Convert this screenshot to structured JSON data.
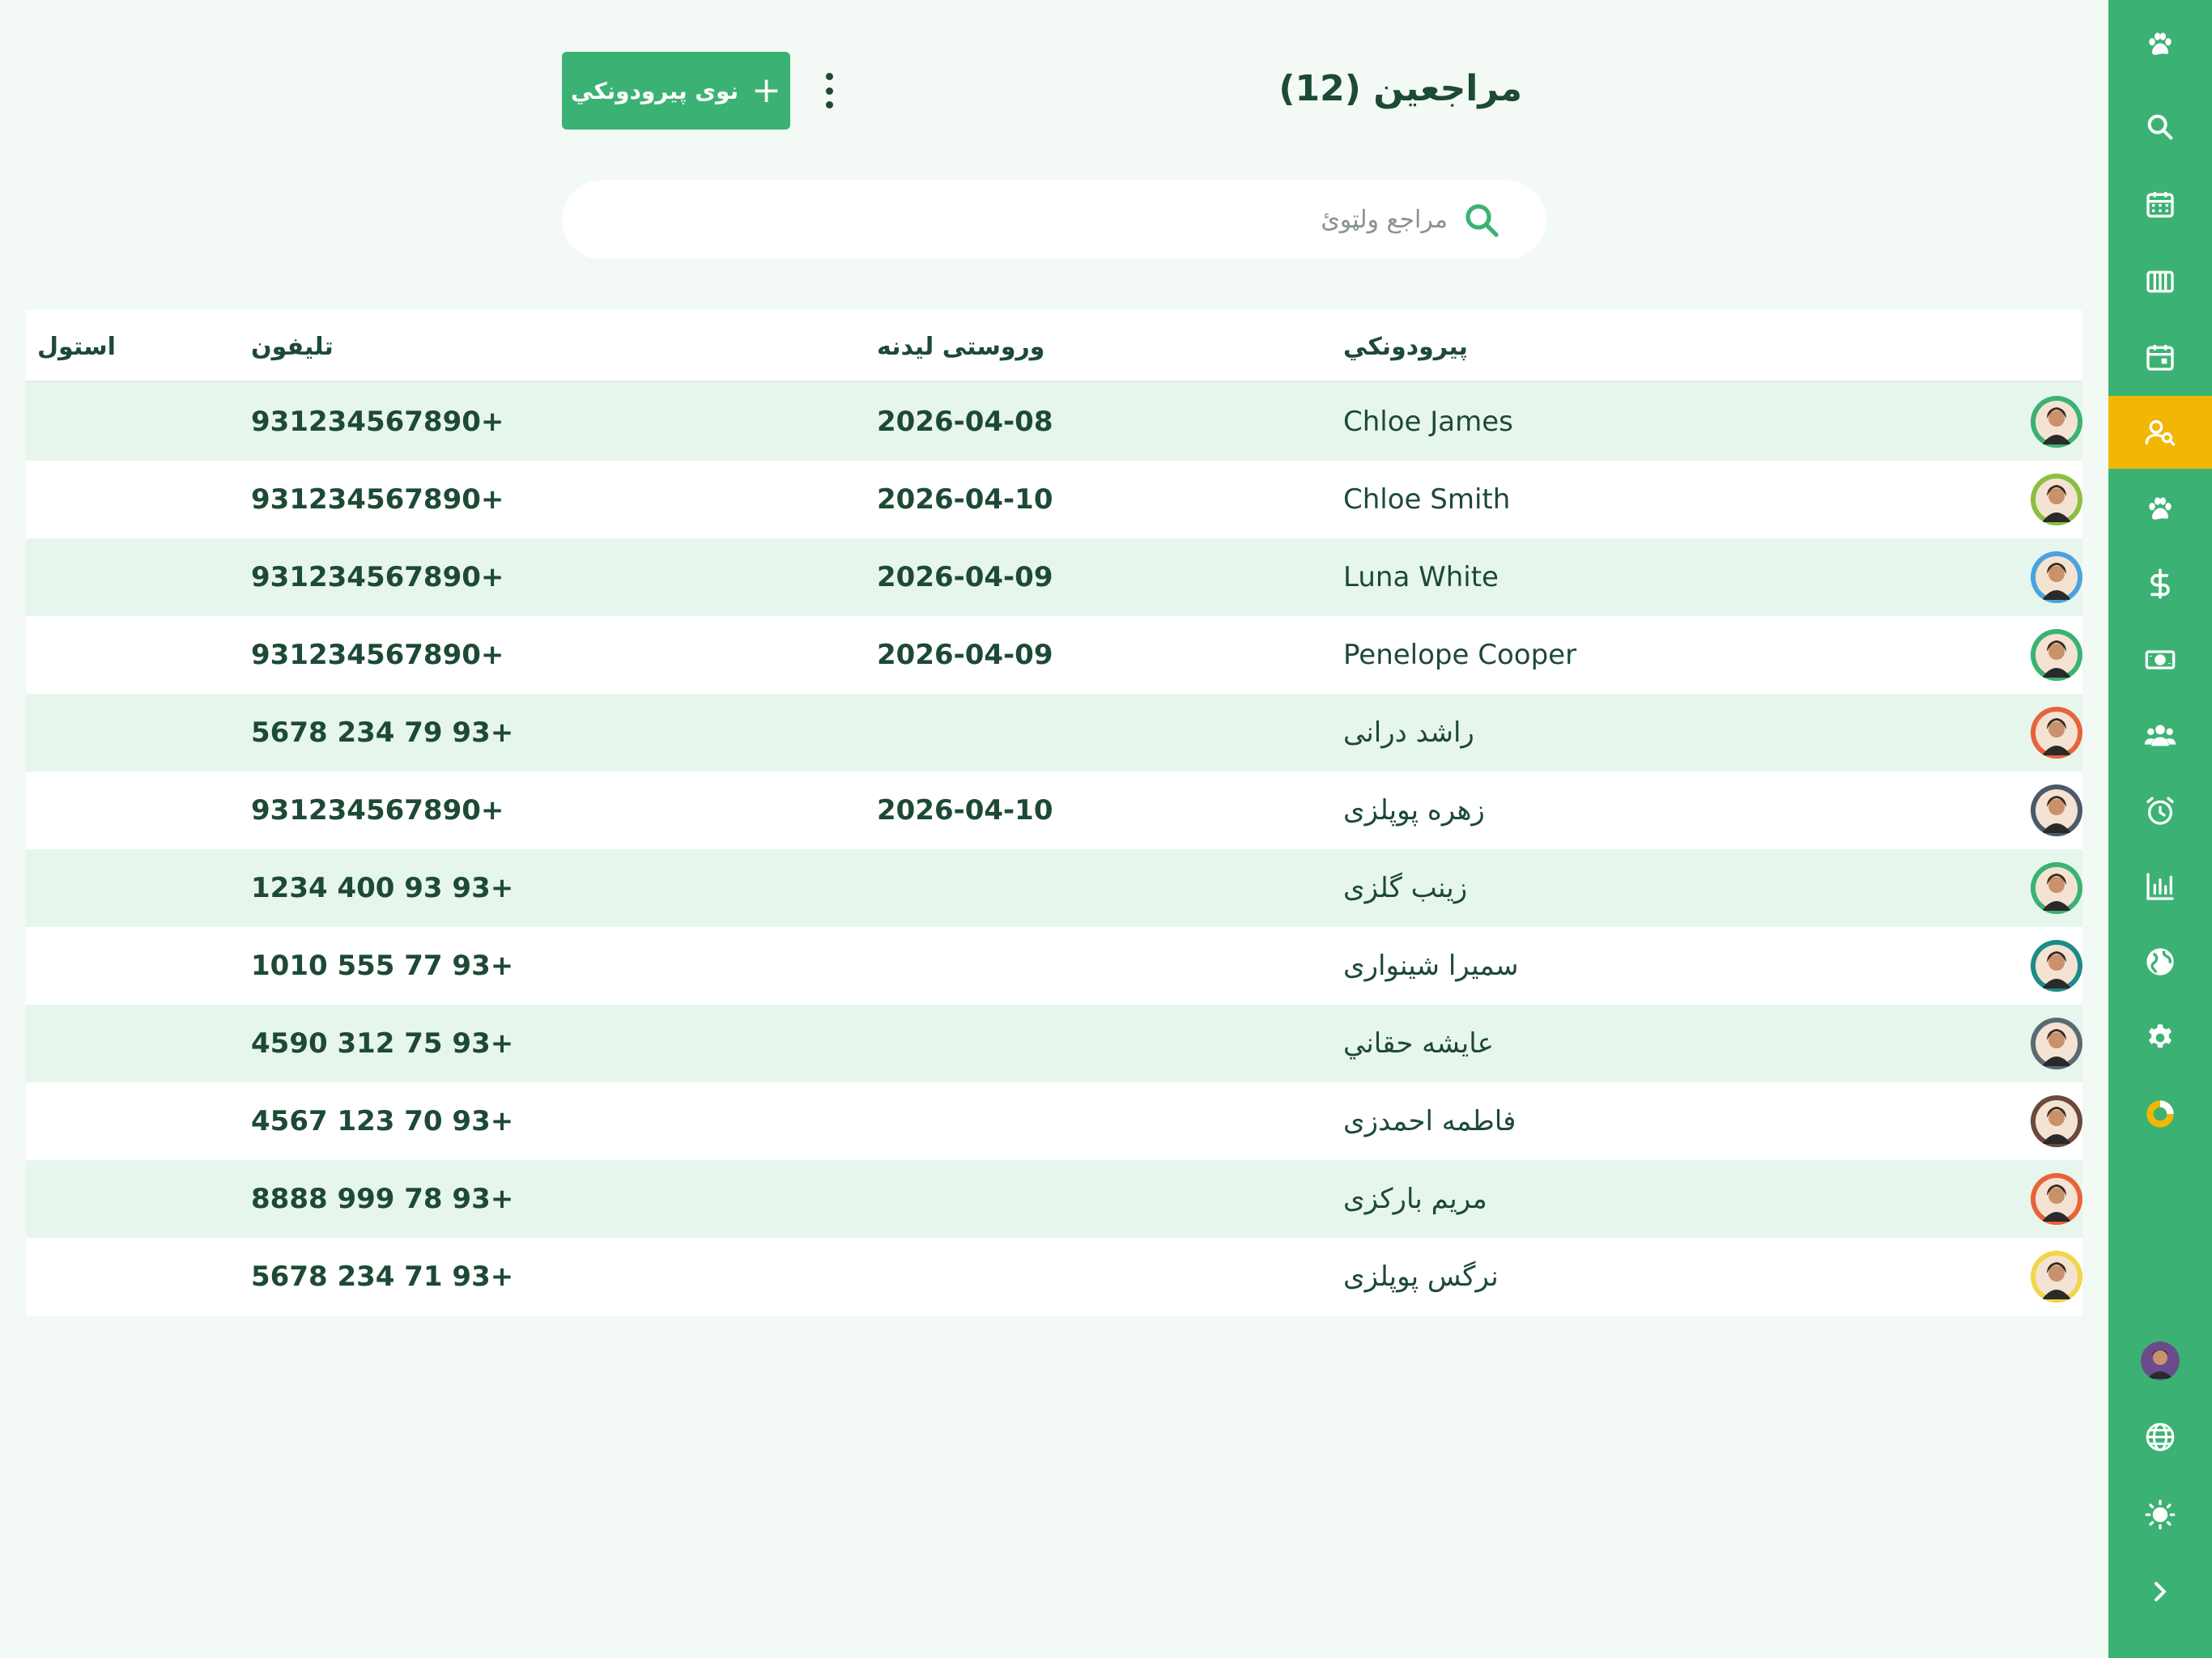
{
  "header": {
    "title": "مراجعين (12)",
    "new_button_label": "نوی پیرودونکي",
    "new_button_icon": "plus-icon",
    "more_icon": "kebab-menu-icon"
  },
  "search": {
    "placeholder": "مراجع ولټوئ",
    "value": "",
    "icon": "search-icon"
  },
  "table": {
    "columns": {
      "customer": "پیرودونکي",
      "last_visit": "وروستی لیدنه",
      "phone": "تلیفون",
      "column": "استول"
    },
    "rows": [
      {
        "name": "Chloe James",
        "date": "2026-04-08",
        "phone": "931234567890+",
        "avatar_color": "#3bb273"
      },
      {
        "name": "Chloe Smith",
        "date": "2026-04-10",
        "phone": "931234567890+",
        "avatar_color": "#8bbf3f"
      },
      {
        "name": "Luna White",
        "date": "2026-04-09",
        "phone": "931234567890+",
        "avatar_color": "#4aa3df"
      },
      {
        "name": "Penelope Cooper",
        "date": "2026-04-09",
        "phone": "931234567890+",
        "avatar_color": "#3bb273"
      },
      {
        "name": "راشد درانی",
        "date": "",
        "phone": "5678 234 79 93+",
        "avatar_color": "#e8633a"
      },
      {
        "name": "زهره پوپلزی",
        "date": "2026-04-10",
        "phone": "931234567890+",
        "avatar_color": "#4a5a6a"
      },
      {
        "name": "زینب گلزی",
        "date": "",
        "phone": "1234 400 93 93+",
        "avatar_color": "#3bb273"
      },
      {
        "name": "سمیرا شینواری",
        "date": "",
        "phone": "1010 555 77 93+",
        "avatar_color": "#1e8a8a"
      },
      {
        "name": "عایشه حقاني",
        "date": "",
        "phone": "4590 312 75 93+",
        "avatar_color": "#5a6a72"
      },
      {
        "name": "فاطمه احمدزی",
        "date": "",
        "phone": "4567 123 70 93+",
        "avatar_color": "#6b4a3a"
      },
      {
        "name": "مریم بارکزی",
        "date": "",
        "phone": "8888 999 78 93+",
        "avatar_color": "#e8633a"
      },
      {
        "name": "نرگس پوپلزی",
        "date": "",
        "phone": "5678 234 71 93+",
        "avatar_color": "#f2d54a"
      }
    ]
  },
  "sidebar": {
    "items": [
      {
        "icon": "paw-logo-icon",
        "active": false
      },
      {
        "icon": "search-icon",
        "active": false
      },
      {
        "icon": "calendar-grid-icon",
        "active": false
      },
      {
        "icon": "columns-icon",
        "active": false
      },
      {
        "icon": "calendar-event-icon",
        "active": false
      },
      {
        "icon": "user-search-icon",
        "active": true
      },
      {
        "icon": "paw-icon",
        "active": false
      },
      {
        "icon": "dollar-icon",
        "active": false
      },
      {
        "icon": "banknote-icon",
        "active": false
      },
      {
        "icon": "users-icon",
        "active": false
      },
      {
        "icon": "alarm-icon",
        "active": false
      },
      {
        "icon": "bar-chart-icon",
        "active": false
      },
      {
        "icon": "globe-filled-icon",
        "active": false
      },
      {
        "icon": "gear-icon",
        "active": false
      },
      {
        "icon": "donut-icon",
        "active": false
      }
    ],
    "bottom": [
      {
        "icon": "user-avatar-icon"
      },
      {
        "icon": "language-icon"
      },
      {
        "icon": "sun-icon"
      },
      {
        "icon": "chevron-right-icon"
      }
    ]
  },
  "colors": {
    "brand": "#3bb273",
    "active": "#f2b705",
    "text": "#1d4a35",
    "row_alt": "#e7f6ec",
    "background": "#f3f9f5"
  }
}
